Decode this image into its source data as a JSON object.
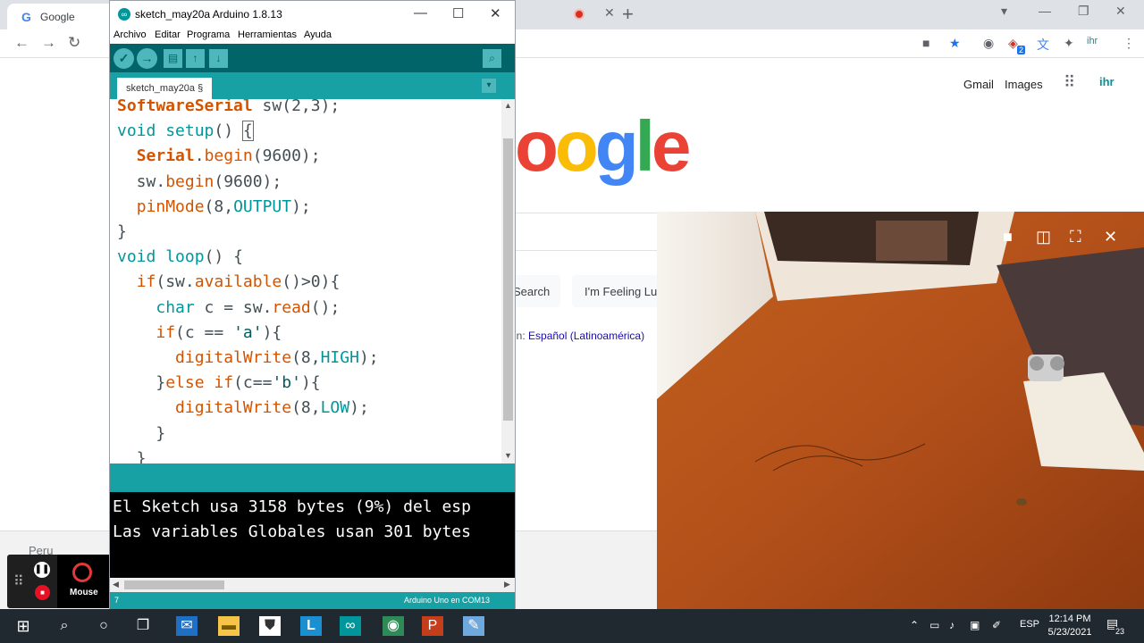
{
  "browser": {
    "tab_title": "Google",
    "tab_favicon_letter": "G",
    "nav": {
      "back_icon": "←",
      "forward_icon": "→",
      "reload_icon": "↻"
    },
    "window_controls": {
      "collapse": "▾",
      "minimize": "—",
      "restore": "❐",
      "close": "✕"
    },
    "new_tab_icon": "+",
    "extension_badges": [
      "2"
    ]
  },
  "google": {
    "links": [
      "Gmail",
      "Images"
    ],
    "logo_letters": [
      {
        "ch": "o",
        "color": "#ea4335"
      },
      {
        "ch": "o",
        "color": "#fbbc05"
      },
      {
        "ch": "g",
        "color": "#4285f4"
      },
      {
        "ch": "l",
        "color": "#34a853"
      },
      {
        "ch": "e",
        "color": "#ea4335"
      }
    ],
    "search_button": "Search",
    "lucky_button": "I'm Feeling Lu",
    "offered_prefix": "in:",
    "offered_lang": "Español (Latinoamérica)",
    "footer_country": "Peru"
  },
  "arduino": {
    "title": "sketch_may20a Arduino 1.8.13",
    "menu": [
      "Archivo",
      "Editar",
      "Programa",
      "Herramientas",
      "Ayuda"
    ],
    "toolbar": {
      "verify": "✓",
      "upload": "→",
      "new": "▤",
      "open": "↑",
      "save": "↓",
      "monitor": "⌕"
    },
    "tab_label": "sketch_may20a §",
    "tab_menu_icon": "▾",
    "console_lines": [
      "El Sketch usa 3158 bytes (9%) del esp",
      "Las variables Globales usan 301 bytes"
    ],
    "line_number": "7",
    "board": "Arduino Uno en COM13"
  },
  "recorder": {
    "mouse_label": "Mouse",
    "pause_icon": "❚❚",
    "stop_icon": "■",
    "drag_icon": "⠿"
  },
  "video_overlay": {
    "controls": [
      "camera-icon",
      "split-icon",
      "fullscreen-icon",
      "close-icon"
    ],
    "colors": {
      "desk": "#b8551d",
      "wall": "#fdfcf9"
    }
  },
  "taskbar": {
    "language": "ESP",
    "time": "12:14 PM",
    "date": "5/23/2021",
    "notifications": "23"
  }
}
